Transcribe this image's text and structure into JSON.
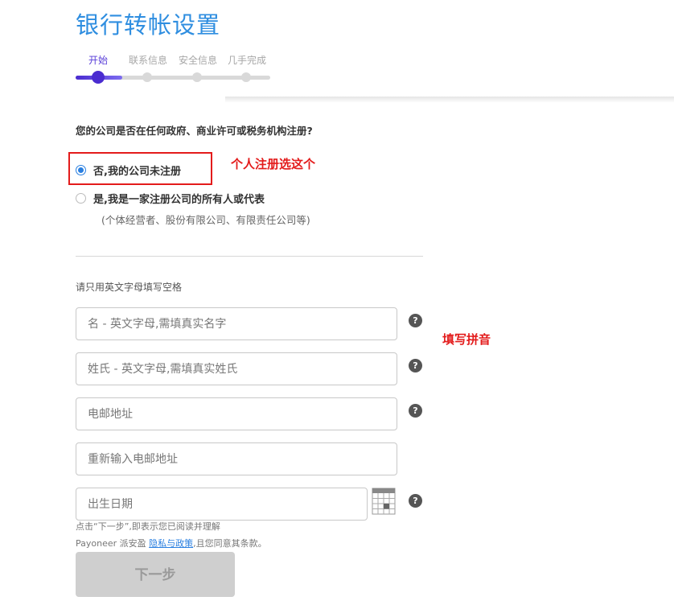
{
  "header": {
    "title": "银行转帐设置",
    "steps": [
      "开始",
      "联系信息",
      "安全信息",
      "几手完成"
    ],
    "active_step": 0
  },
  "form": {
    "question": "您的公司是否在任何政府、商业许可或税务机构注册?",
    "options": [
      {
        "label": "否,我的公司未注册",
        "checked": true
      },
      {
        "label": "是,我是一家注册公司的所有人或代表",
        "checked": false
      }
    ],
    "option_note": "(个体经营者、股份有限公司、有限责任公司等)",
    "hint": "请只用英文字母填写空格",
    "fields": [
      {
        "placeholder": "名 - 英文字母,需填真实名字",
        "value": ""
      },
      {
        "placeholder": "姓氏 - 英文字母,需填真实姓氏",
        "value": ""
      },
      {
        "placeholder": "电邮地址",
        "value": ""
      },
      {
        "placeholder": "重新输入电邮地址",
        "value": ""
      },
      {
        "placeholder": "出生日期",
        "value": ""
      }
    ],
    "help_glyph": "?",
    "terms_line1": "点击“下一步”,即表示您已阅读并理解",
    "terms_line2_prefix": "Payoneer 派安盈 ",
    "terms_link": "隐私与政策",
    "terms_line2_suffix": ",且您同意其条款。",
    "next_label": "下一步"
  },
  "annotations": {
    "personal": "个人注册选这个",
    "pinyin": "填写拼音"
  },
  "colors": {
    "title": "#2f8ee0",
    "step_active": "#4a2cd0",
    "annotation": "#e31b1b",
    "link": "#2a7fe0"
  }
}
